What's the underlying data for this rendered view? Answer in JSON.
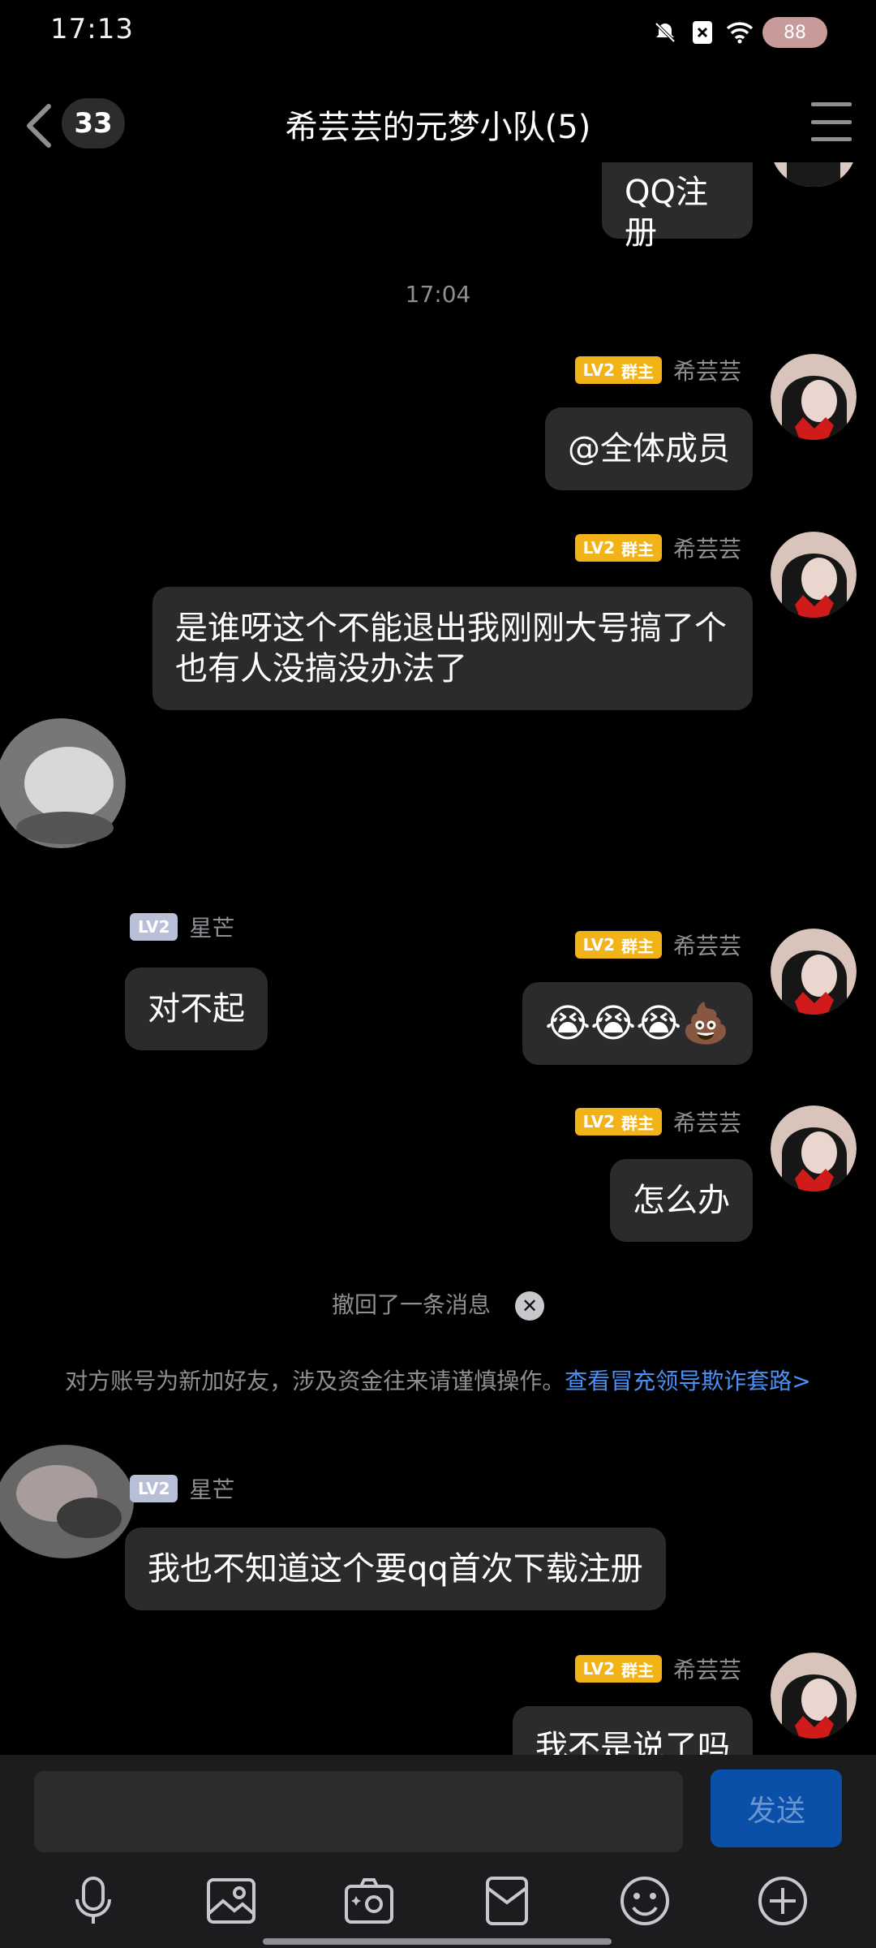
{
  "status_bar": {
    "time": "17:13",
    "battery": "88"
  },
  "header": {
    "unread_count": "33",
    "title": "希芸芸的元梦小队(5)"
  },
  "messages": [
    {
      "type": "self",
      "text": "QQ注册",
      "partial": true
    },
    {
      "type": "timestamp",
      "text": "17:04"
    },
    {
      "type": "self",
      "level": "LV2",
      "role": "群主",
      "sender": "希芸芸",
      "text": "@全体成员"
    },
    {
      "type": "self",
      "level": "LV2",
      "role": "群主",
      "sender": "希芸芸",
      "text": "是谁呀这个不能退出我刚刚大号搞了个也有人没搞没办法了"
    },
    {
      "type": "other",
      "level": "LV2",
      "sender": "星芒",
      "text": "对不起"
    },
    {
      "type": "self",
      "level": "LV2",
      "role": "群主",
      "sender": "希芸芸",
      "text": "😭😭😭💩"
    },
    {
      "type": "self",
      "level": "LV2",
      "role": "群主",
      "sender": "希芸芸",
      "text": "怎么办"
    },
    {
      "type": "system",
      "text": "撤回了一条消息"
    },
    {
      "type": "warning",
      "text": "对方账号为新加好友，涉及资金往来请谨慎操作。",
      "link": "查看冒充领导欺诈套路>"
    },
    {
      "type": "other",
      "level": "LV2",
      "sender": "星芒",
      "text": "我也不知道这个要qq首次下载注册"
    },
    {
      "type": "self",
      "level": "LV2",
      "role": "群主",
      "sender": "希芸芸",
      "text": "我不是说了吗",
      "partial": true
    }
  ],
  "input": {
    "placeholder": "",
    "send_label": "发送"
  },
  "toolbar": [
    "voice-icon",
    "image-icon",
    "camera-icon",
    "red-packet-icon",
    "emoji-icon",
    "plus-icon"
  ],
  "colors": {
    "accent": "#0a4fa8",
    "badge_gold": "#f2b318",
    "link": "#4a90f5",
    "bubble": "#2b2b2d"
  }
}
